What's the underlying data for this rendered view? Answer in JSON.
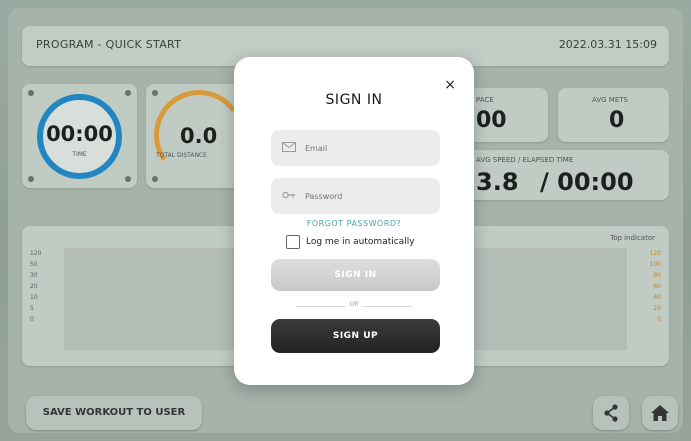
{
  "header": {
    "program": "PROGRAM - QUICK START",
    "datetime": "2022.03.31 15:09"
  },
  "stats": {
    "time_value": "00:00",
    "time_label": "TIME",
    "distance_value": "0.0",
    "distance_label": "TOTAL DISTANCE",
    "pace_label": "PACE",
    "pace_value": "00",
    "avg_mets_label": "AVG METS",
    "avg_mets_value": "0",
    "speed_time_label": "AVG SPEED / ELAPSED TIME",
    "speed_value": "3.8",
    "elapsed_value": "/ 00:00"
  },
  "chart": {
    "title": "Top indicator",
    "left_ticks": [
      "120",
      "50",
      "30",
      "20",
      "10",
      "5",
      "0"
    ],
    "right_ticks": [
      "120",
      "100",
      "80",
      "60",
      "40",
      "20",
      "0"
    ]
  },
  "bottom": {
    "save_label": "SAVE WORKOUT TO USER"
  },
  "modal": {
    "title": "SIGN IN",
    "close_glyph": "×",
    "email_placeholder": "Email",
    "password_placeholder": "Password",
    "forgot_label": "FORGOT PASSWORD?",
    "remember_label": "Log me in automatically",
    "remember_checked": false,
    "signin_label": "SIGN IN",
    "or_label": "OR",
    "signup_label": "SIGN UP"
  },
  "colors": {
    "ring": "#1f8ed3",
    "arc": "#f0a43a",
    "signup_bg": "#232323",
    "forgot": "#4aa6a6"
  }
}
